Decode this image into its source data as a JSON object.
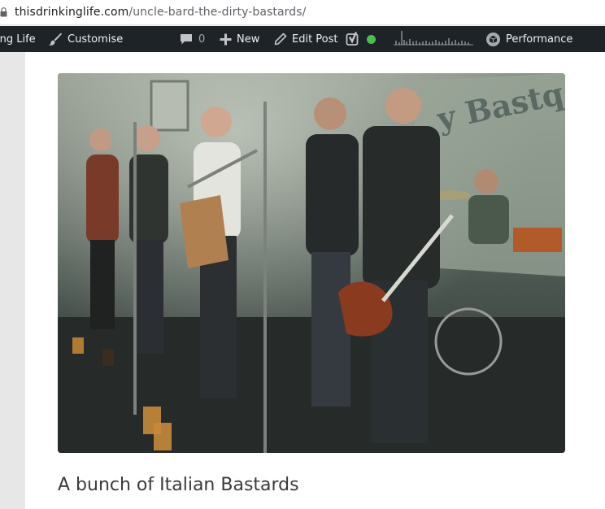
{
  "browser": {
    "url_domain": "thisdrinkinglife.com",
    "url_path": "/uncle-bard-the-dirty-bastards/"
  },
  "admin_bar": {
    "site_name": "ing Life",
    "customise_label": "Customise",
    "comments_count": "0",
    "new_label": "New",
    "edit_post_label": "Edit Post",
    "performance_label": "Performance",
    "status_color": "#47c148"
  },
  "post": {
    "image_caption": "A bunch of Italian Bastards"
  },
  "colors": {
    "admin_bar_bg": "#1d2327",
    "admin_bar_text": "#f0f0f1"
  }
}
